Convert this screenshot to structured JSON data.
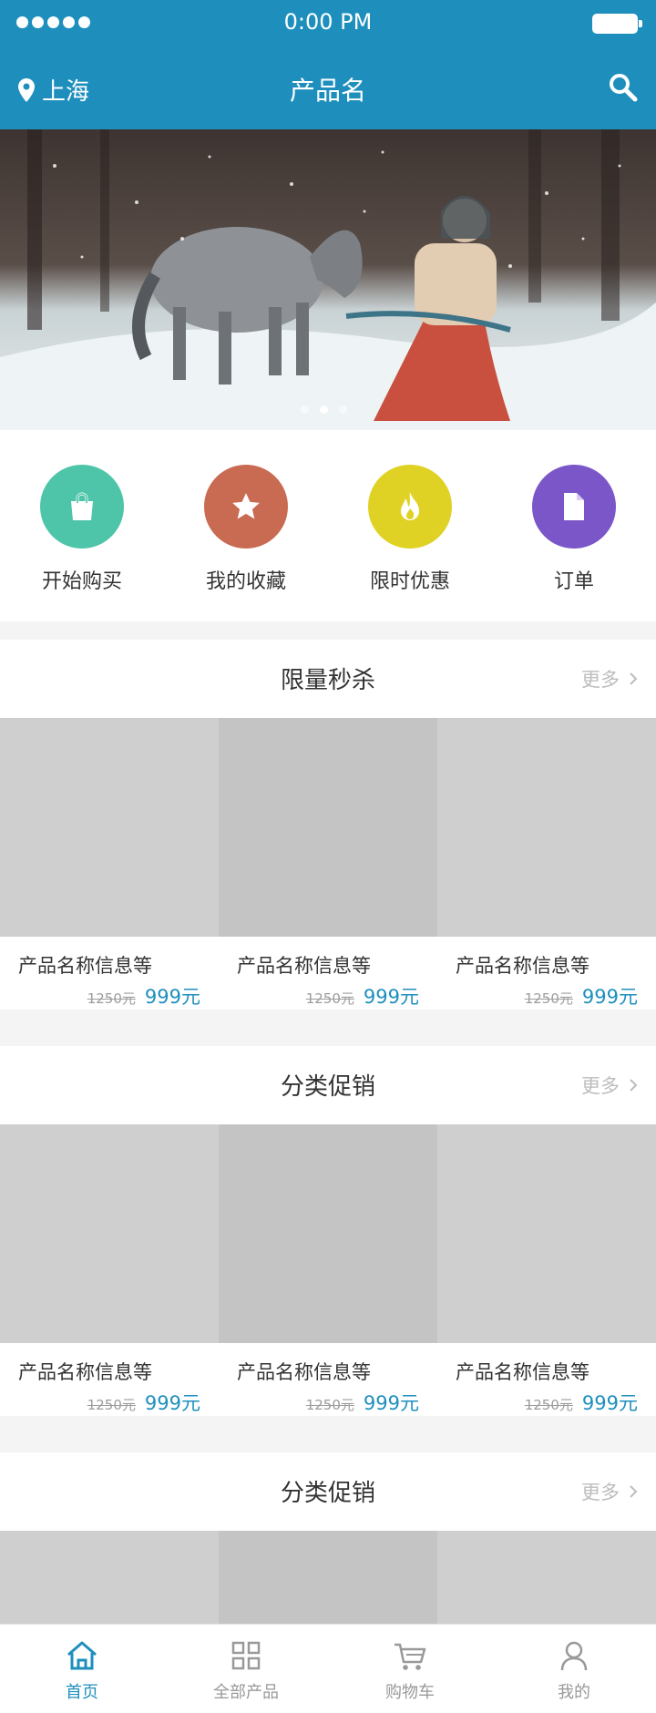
{
  "status_bar": {
    "time": "0:00 PM"
  },
  "header": {
    "location": "上海",
    "title": "产品名"
  },
  "quick_entries": [
    {
      "label": "开始购买",
      "icon": "shopping-bag-icon",
      "color": "#4ec5a8"
    },
    {
      "label": "我的收藏",
      "icon": "star-icon",
      "color": "#c96a52"
    },
    {
      "label": "限时优惠",
      "icon": "flame-icon",
      "color": "#e0d224"
    },
    {
      "label": "订单",
      "icon": "document-icon",
      "color": "#7a56c8"
    }
  ],
  "sections": [
    {
      "title": "限量秒杀",
      "more": "更多",
      "products": [
        {
          "name": "产品名称信息等",
          "old_price": "1250元",
          "price": "999元"
        },
        {
          "name": "产品名称信息等",
          "old_price": "1250元",
          "price": "999元"
        },
        {
          "name": "产品名称信息等",
          "old_price": "1250元",
          "price": "999元"
        }
      ]
    },
    {
      "title": "分类促销",
      "more": "更多",
      "products": [
        {
          "name": "产品名称信息等",
          "old_price": "1250元",
          "price": "999元"
        },
        {
          "name": "产品名称信息等",
          "old_price": "1250元",
          "price": "999元"
        },
        {
          "name": "产品名称信息等",
          "old_price": "1250元",
          "price": "999元"
        }
      ]
    },
    {
      "title": "分类促销",
      "more": "更多",
      "products": [
        {
          "name": "",
          "old_price": "",
          "price": ""
        },
        {
          "name": "",
          "old_price": "",
          "price": ""
        },
        {
          "name": "",
          "old_price": "",
          "price": ""
        }
      ]
    }
  ],
  "tab_bar": [
    {
      "label": "首页",
      "icon": "home-icon",
      "active": true
    },
    {
      "label": "全部产品",
      "icon": "grid-icon",
      "active": false
    },
    {
      "label": "购物车",
      "icon": "cart-icon",
      "active": false
    },
    {
      "label": "我的",
      "icon": "user-icon",
      "active": false
    }
  ],
  "colors": {
    "primary": "#1e8fbd",
    "price": "#1e8fbd",
    "placeholder": "#cfcfcf"
  }
}
